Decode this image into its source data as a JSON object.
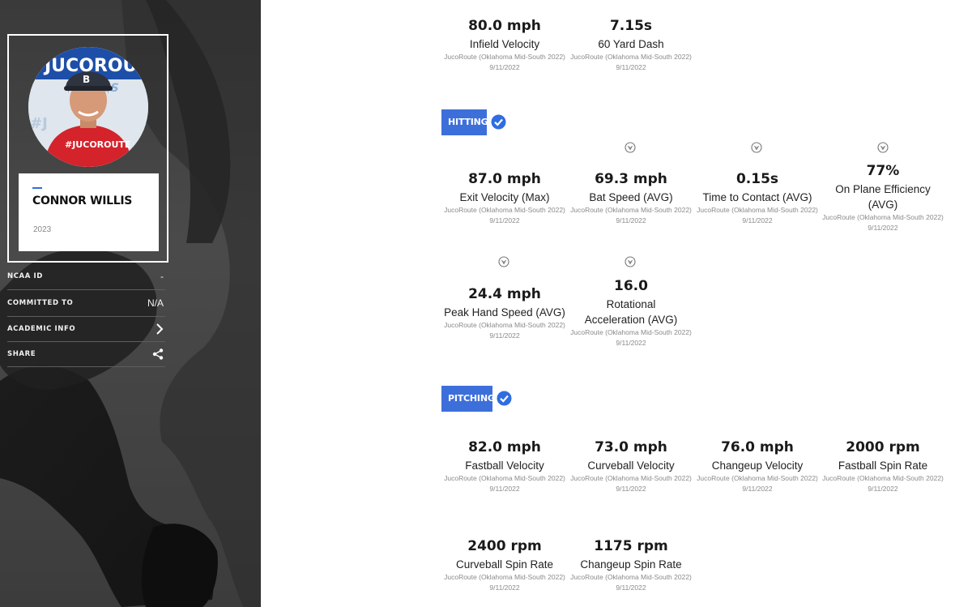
{
  "player": {
    "name": "CONNOR WILLIS",
    "grad_year": "2023"
  },
  "info": [
    {
      "label": "NCAA ID",
      "value": "-"
    },
    {
      "label": "COMMITTED TO",
      "value": "N/A"
    },
    {
      "label": "ACADEMIC INFO",
      "icon": "chevron-right-icon"
    },
    {
      "label": "SHARE",
      "icon": "share-icon"
    }
  ],
  "top_stats": [
    {
      "value": "80.0 mph",
      "name": "Infield Velocity",
      "source": "JucoRoute (Oklahoma Mid-South 2022) 9/11/2022"
    },
    {
      "value": "7.15s",
      "name": "60 Yard Dash",
      "source": "JucoRoute (Oklahoma Mid-South 2022) 9/11/2022"
    }
  ],
  "hitting": {
    "label": "HITTING",
    "stats": [
      {
        "value": "87.0 mph",
        "name": "Exit Velocity (Max)",
        "source": "JucoRoute (Oklahoma Mid-South 2022) 9/11/2022"
      },
      {
        "value": "69.3 mph",
        "name": "Bat Speed (AVG)",
        "source": "JucoRoute (Oklahoma Mid-South 2022) 9/11/2022"
      },
      {
        "value": "0.15s",
        "name": "Time to Contact (AVG)",
        "source": "JucoRoute (Oklahoma Mid-South 2022) 9/11/2022"
      },
      {
        "value": "77%",
        "name": "On Plane Efficiency (AVG)",
        "source": "JucoRoute (Oklahoma Mid-South 2022) 9/11/2022"
      },
      {
        "value": "24.4 mph",
        "name": "Peak Hand Speed (AVG)",
        "source": "JucoRoute (Oklahoma Mid-South 2022) 9/11/2022"
      },
      {
        "value": "16.0",
        "name": "Rotational Acceleration (AVG)",
        "source": "JucoRoute (Oklahoma Mid-South 2022) 9/11/2022"
      }
    ]
  },
  "pitching": {
    "label": "PITCHING",
    "stats": [
      {
        "value": "82.0 mph",
        "name": "Fastball Velocity",
        "source": "JucoRoute (Oklahoma Mid-South 2022) 9/11/2022"
      },
      {
        "value": "73.0 mph",
        "name": "Curveball Velocity",
        "source": "JucoRoute (Oklahoma Mid-South 2022) 9/11/2022"
      },
      {
        "value": "76.0 mph",
        "name": "Changeup Velocity",
        "source": "JucoRoute (Oklahoma Mid-South 2022) 9/11/2022"
      },
      {
        "value": "2000 rpm",
        "name": "Fastball Spin Rate",
        "source": "JucoRoute (Oklahoma Mid-South 2022) 9/11/2022"
      },
      {
        "value": "2400 rpm",
        "name": "Curveball Spin Rate",
        "source": "JucoRoute (Oklahoma Mid-South 2022) 9/11/2022"
      },
      {
        "value": "1175 rpm",
        "name": "Changeup Spin Rate",
        "source": "JucoRoute (Oklahoma Mid-South 2022) 9/11/2022"
      }
    ]
  },
  "colors": {
    "accent": "#3d6fdb",
    "verified": "#2f6ee0",
    "sidebar": "#3f3f3f"
  },
  "photo_shirt_text": "#JUCOROUTE"
}
